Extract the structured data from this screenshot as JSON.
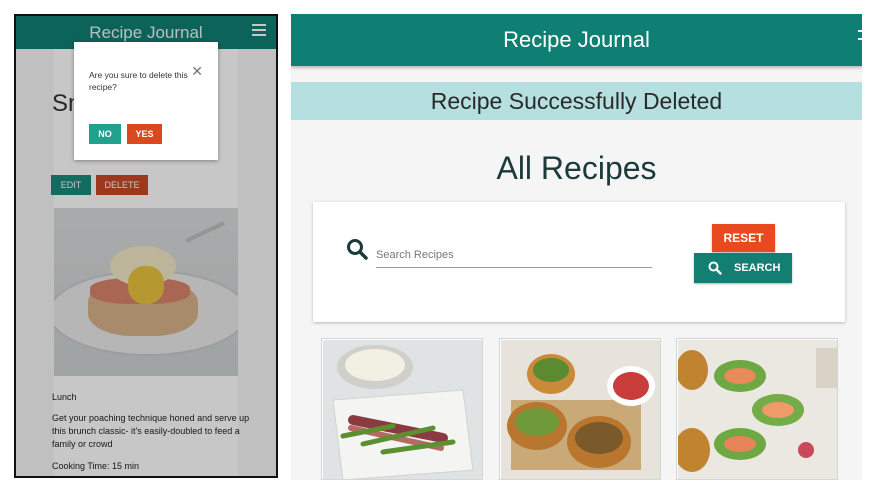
{
  "mobile": {
    "app_title": "Recipe Journal",
    "recipe_title": "Sm… …n &",
    "buttons": {
      "edit": "EDIT",
      "delete": "DELETE"
    },
    "category": "Lunch",
    "description": "Get your poaching technique honed and serve up this brunch classic- it's easily-doubled to feed a family or crowd",
    "cooking_time": "Cooking Time: 15 min",
    "modal": {
      "message": "Are you sure to delete this recipe?",
      "no_label": "NO",
      "yes_label": "YES",
      "close_icon": "close-icon"
    },
    "menu_icon": "hamburger-icon"
  },
  "desktop": {
    "app_title": "Recipe Journal",
    "banner": "Recipe Successfully Deleted",
    "heading": "All Recipes",
    "search": {
      "placeholder": "Search Recipes",
      "reset_label": "RESET",
      "search_label": "SEARCH",
      "icon": "search-icon"
    }
  },
  "colors": {
    "primary": "#0f7f73",
    "accent": "#e8491f",
    "banner": "#b5e0df"
  }
}
